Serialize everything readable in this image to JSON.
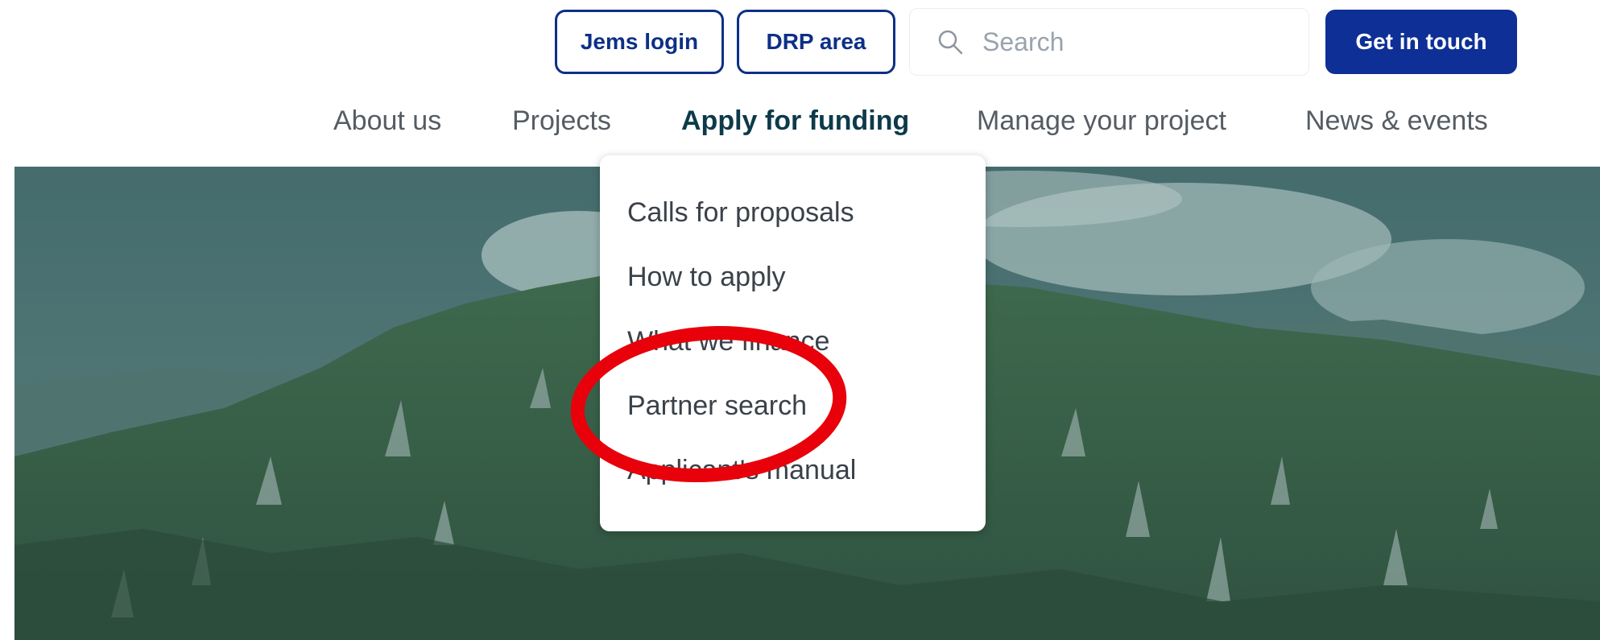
{
  "header": {
    "jems_login_label": "Jems login",
    "drp_area_label": "DRP area",
    "search": {
      "placeholder": "Search",
      "icon": "search-icon"
    },
    "contact_label": "Get in touch"
  },
  "nav": {
    "items": [
      {
        "label": "About us"
      },
      {
        "label": "Projects"
      },
      {
        "label": "Apply for funding",
        "active": true
      },
      {
        "label": "Manage your project"
      },
      {
        "label": "News & events"
      }
    ]
  },
  "dropdown": {
    "items": [
      {
        "label": "Calls for proposals"
      },
      {
        "label": "How to apply"
      },
      {
        "label": "What we finance"
      },
      {
        "label": "Partner search"
      },
      {
        "label": "Applicant's manual"
      }
    ]
  },
  "annotation": {
    "shape": "ellipse",
    "color": "#e8000a",
    "highlights": "Partner search"
  },
  "colors": {
    "brand_blue": "#0d2f96",
    "active_nav": "#0d3a4a",
    "nav_text": "#555c63",
    "hero_tint": "#3f6566"
  }
}
